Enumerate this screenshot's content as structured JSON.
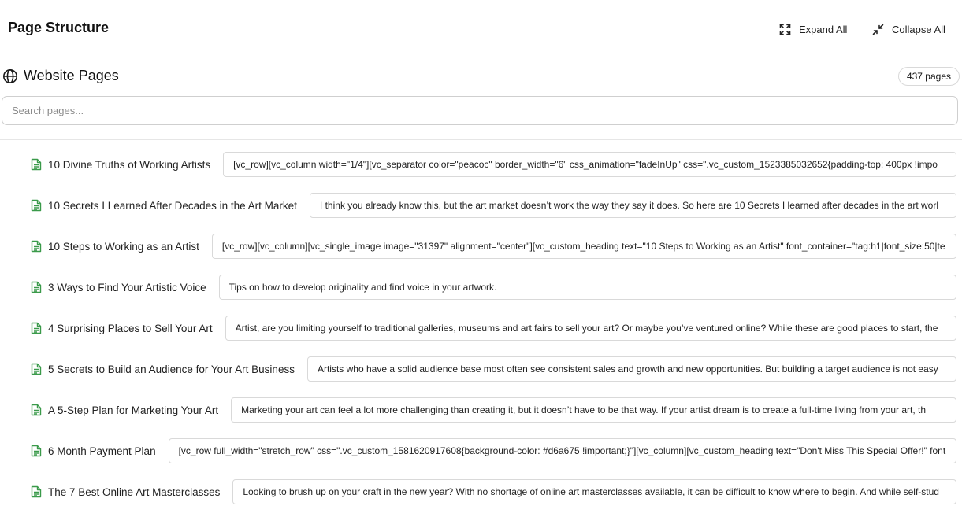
{
  "header": {
    "title": "Page Structure",
    "expand_all_label": "Expand All",
    "collapse_all_label": "Collapse All"
  },
  "section": {
    "icon": "globe-icon",
    "title": "Website Pages",
    "count_label": "437 pages"
  },
  "search": {
    "placeholder": "Search pages...",
    "value": ""
  },
  "pages": [
    {
      "title": "10 Divine Truths of Working Artists",
      "content": "[vc_row][vc_column width=\"1/4\"][vc_separator color=\"peacoc\" border_width=\"6\" css_animation=\"fadeInUp\" css=\".vc_custom_1523385032652{padding-top: 400px !impo"
    },
    {
      "title": "10 Secrets I Learned After Decades in the Art Market",
      "content": "I think you already know this, but the art market doesn’t work the way they say it does. So here are 10 Secrets I learned after decades in the art worl"
    },
    {
      "title": "10 Steps to Working as an Artist",
      "content": "[vc_row][vc_column][vc_single_image image=\"31397\" alignment=\"center\"][vc_custom_heading text=\"10 Steps to Working as an Artist\" font_container=\"tag:h1|font_size:50|te"
    },
    {
      "title": "3 Ways to Find Your Artistic Voice",
      "content": "Tips on how to develop originality and find voice in your artwork."
    },
    {
      "title": "4 Surprising Places to Sell Your Art",
      "content": "Artist, are you limiting yourself to traditional galleries, museums and art fairs to sell your art? Or maybe you’ve ventured online? While these are good places to start, the"
    },
    {
      "title": "5 Secrets to Build an Audience for Your Art Business",
      "content": "Artists who have a solid audience base most often see consistent sales and growth and new opportunities. But building a target audience is not easy"
    },
    {
      "title": "A 5-Step Plan for Marketing Your Art",
      "content": "Marketing your art can feel a lot more challenging than creating it, but it doesn’t have to be that way. If your artist dream is to create a full-time living from your art, th"
    },
    {
      "title": "6 Month Payment Plan",
      "content": "[vc_row full_width=\"stretch_row\" css=\".vc_custom_1581620917608{background-color: #d6a675 !important;}\"][vc_column][vc_custom_heading text=\"Don't Miss This Special Offer!\" font"
    },
    {
      "title": "The 7 Best Online Art Masterclasses",
      "content": "Looking to brush up on your craft in the new year? With no shortage of online art masterclasses available, it can be difficult to know where to begin. And while self-stud"
    }
  ],
  "colors": {
    "doc_icon": "#3a9a4a",
    "border": "#d9d9d9",
    "text": "#222222"
  }
}
